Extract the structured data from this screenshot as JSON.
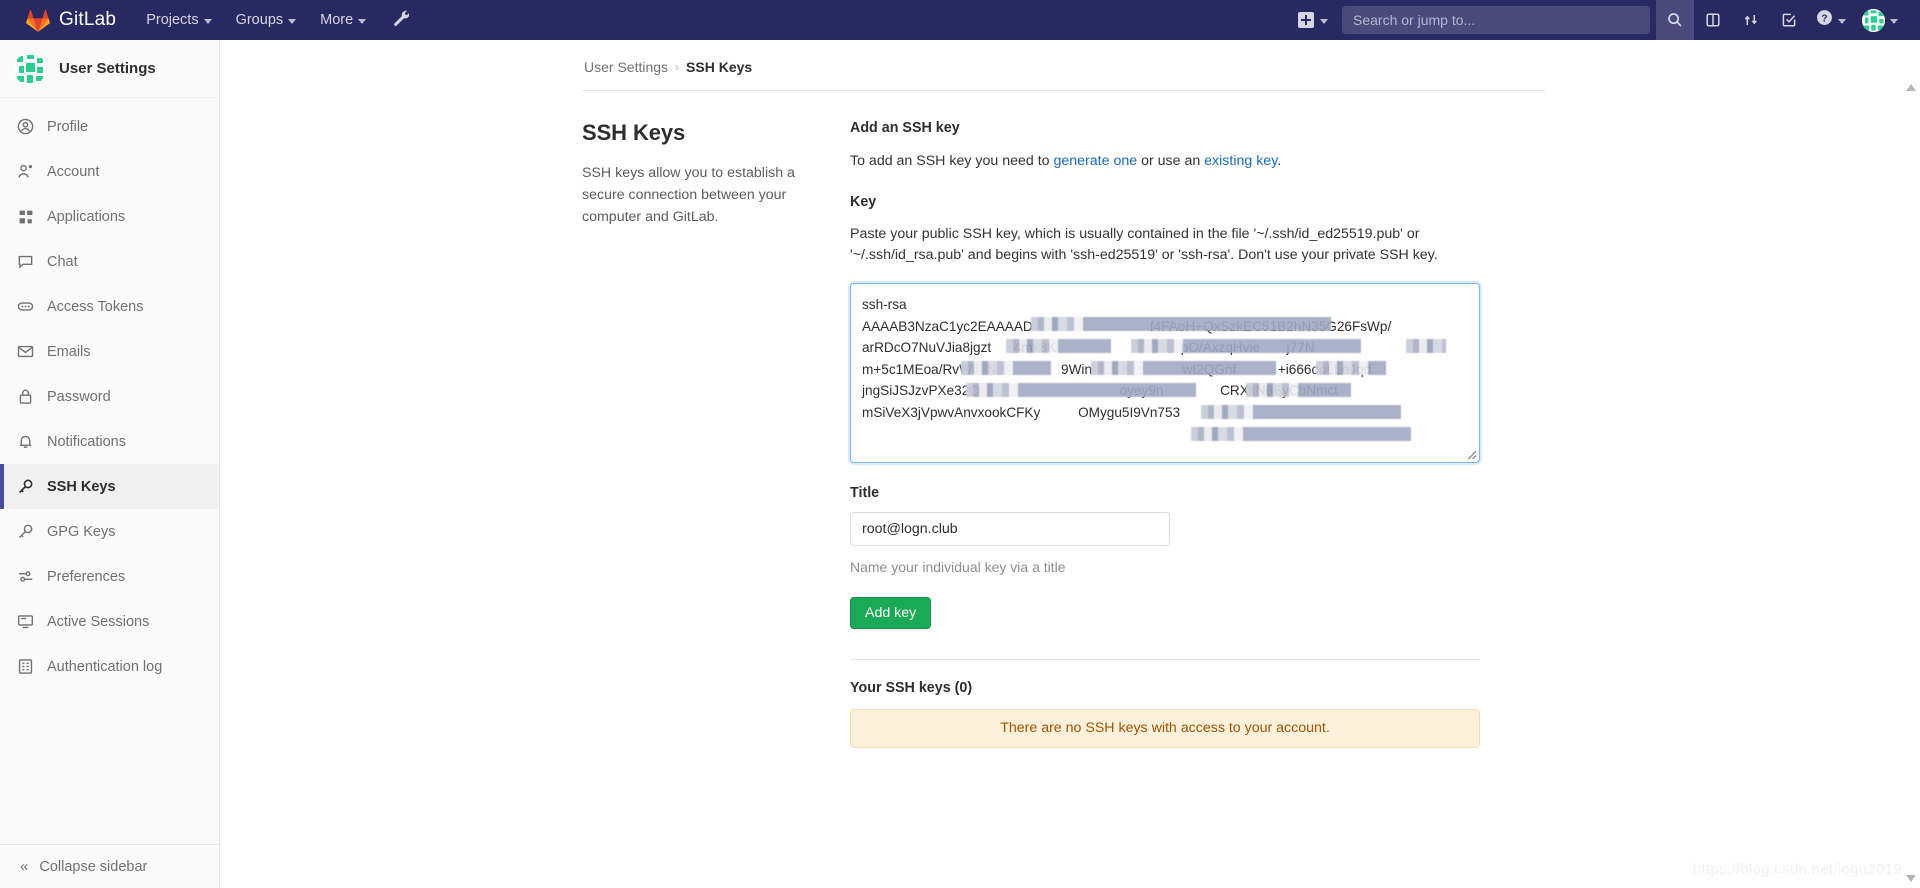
{
  "navbar": {
    "brand": "GitLab",
    "brand_icon": "gitlab-logo-icon",
    "items": [
      {
        "label": "Projects",
        "icon": "chevron-down-icon"
      },
      {
        "label": "Groups",
        "icon": "chevron-down-icon"
      },
      {
        "label": "More",
        "icon": "chevron-down-icon"
      }
    ],
    "wrench_icon": "wrench-icon",
    "create_new_icon": "plus-square-icon",
    "search": {
      "placeholder": "Search or jump to...",
      "value": ""
    },
    "icons": [
      {
        "name": "search-icon"
      },
      {
        "name": "issues-board-icon"
      },
      {
        "name": "merge-request-icon"
      },
      {
        "name": "todos-checkmark-icon"
      },
      {
        "name": "help-question-icon"
      },
      {
        "name": "user-avatar-icon"
      }
    ],
    "bg_color": "#292961",
    "search_bg_color": "#4a4a7d"
  },
  "sidebar": {
    "title": "User Settings",
    "avatar_icon": "user-avatar-identicon",
    "active_item": "SSH Keys",
    "active_accent_color": "#4c4c9e",
    "items": [
      {
        "label": "Profile",
        "icon": "user-circle-icon"
      },
      {
        "label": "Account",
        "icon": "account-gear-icon"
      },
      {
        "label": "Applications",
        "icon": "applications-grid-icon"
      },
      {
        "label": "Chat",
        "icon": "chat-bubble-icon"
      },
      {
        "label": "Access Tokens",
        "icon": "token-pill-icon"
      },
      {
        "label": "Emails",
        "icon": "envelope-icon"
      },
      {
        "label": "Password",
        "icon": "lock-icon"
      },
      {
        "label": "Notifications",
        "icon": "bell-icon"
      },
      {
        "label": "SSH Keys",
        "icon": "key-icon"
      },
      {
        "label": "GPG Keys",
        "icon": "key-icon"
      },
      {
        "label": "Preferences",
        "icon": "sliders-icon"
      },
      {
        "label": "Active Sessions",
        "icon": "monitor-icon"
      },
      {
        "label": "Authentication log",
        "icon": "list-log-icon"
      }
    ],
    "collapse": {
      "label": "Collapse sidebar",
      "icon": "chevron-double-left-icon"
    }
  },
  "breadcrumb": {
    "parent": "User Settings",
    "separator": "›",
    "current": "SSH Keys"
  },
  "left_column": {
    "title": "SSH Keys",
    "description": "SSH keys allow you to establish a secure connection between your computer and GitLab."
  },
  "form": {
    "heading": "Add an SSH key",
    "intro_prefix": "To add an SSH key you need to ",
    "link_generate": "generate one",
    "intro_middle": " or use an ",
    "link_existing": "existing key",
    "intro_suffix": ".",
    "key_label": "Key",
    "key_help": "Paste your public SSH key, which is usually contained in the file '~/.ssh/id_ed25519.pub' or '~/.ssh/id_rsa.pub' and begins with 'ssh-ed25519' or 'ssh-rsa'. Don't use your private SSH key.",
    "key_value": "ssh-rsa\nAAAAB3NzaC1yc2EAAAAD                               f4FAoH+QxSzkEC51B2hN35G26FsWp/\narRDcO7NuVJia8jgzt      4mk8K                                 pO/AxzqHvie       j77N\nm+5c1MEoa/RvW    N                 9Win                        wt2QGnf           +i666ooLLoJqd\njngSiJSJzvPXe32O                                     oyey9n               CRXxN8ByCbNmct\nmSiVeX3jVpwvAnvxookCFKy          OMygu5I9Vn753",
    "key_placeholder": "",
    "title_label": "Title",
    "title_value": "root@logn.club",
    "title_help": "Name your individual key via a title",
    "submit_label": "Add key",
    "submit_color": "#1aaa55"
  },
  "keys_section": {
    "heading": "Your SSH keys (0)",
    "empty_message": "There are no SSH keys with access to your account.",
    "empty_bg_color": "#fdf1dc",
    "empty_text_color": "#a35200"
  },
  "watermark": "https://blog.csdn.net/logn2019"
}
